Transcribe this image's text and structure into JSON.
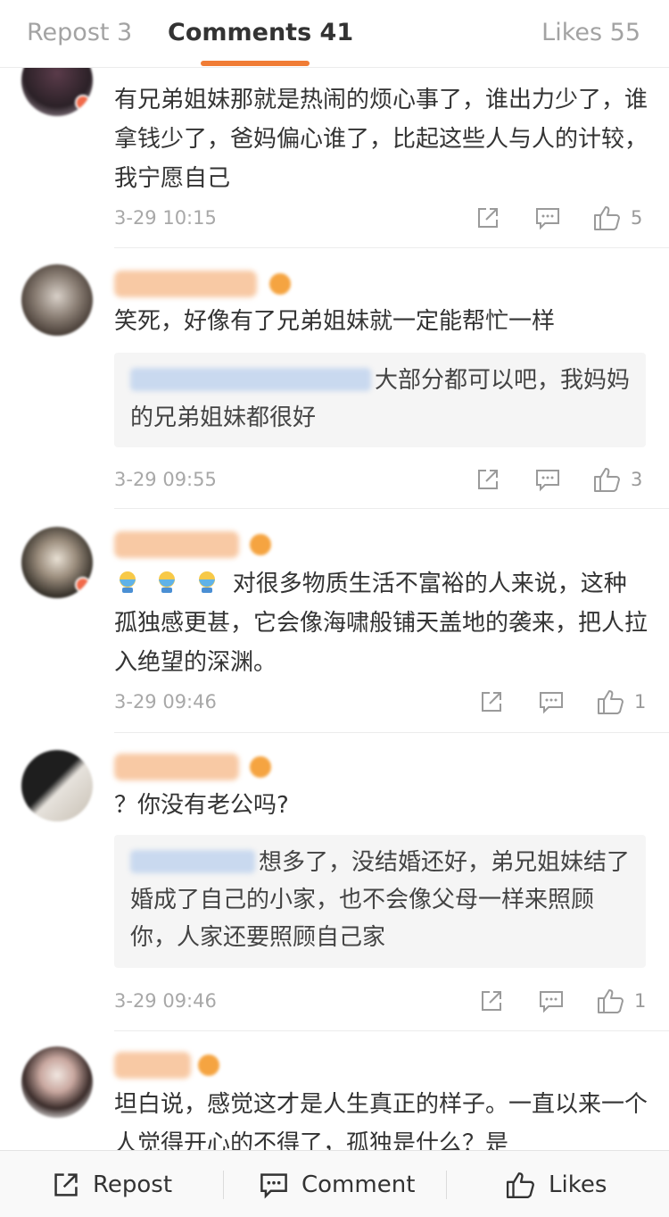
{
  "tabs": {
    "repost": "Repost 3",
    "comments": "Comments 41",
    "likes": "Likes 55"
  },
  "comments": [
    {
      "text": "有兄弟姐妹那就是热闹的烦心事了，谁出力少了，谁拿钱少了，爸妈偏心谁了，比起这些人与人的计较，我宁愿自己",
      "time": "3-29 10:15",
      "likes": "5"
    },
    {
      "text": "笑死，好像有了兄弟姐妹就一定能帮忙一样",
      "reply": "大部分都可以吧，我妈妈的兄弟姐妹都很好",
      "time": "3-29 09:55",
      "likes": "3"
    },
    {
      "text": "对很多物质生活不富裕的人来说，这种孤独感更甚，它会像海啸般铺天盖地的袭来，把人拉入绝望的深渊。",
      "time": "3-29 09:46",
      "likes": "1"
    },
    {
      "text": "？你没有老公吗?",
      "reply": "想多了，没结婚还好，弟兄姐妹结了婚成了自己的小家，也不会像父母一样来照顾你，人家还要照顾自己家",
      "time": "3-29 09:46",
      "likes": "1"
    },
    {
      "text": "坦白说，感觉这才是人生真正的样子。一直以来一个人觉得开心的不得了，孤独是什么？是"
    }
  ],
  "bottom_bar": {
    "repost": "Repost",
    "comment": "Comment",
    "likes": "Likes"
  },
  "colors": {
    "accent": "#f07c35",
    "username": "#f5a441"
  }
}
